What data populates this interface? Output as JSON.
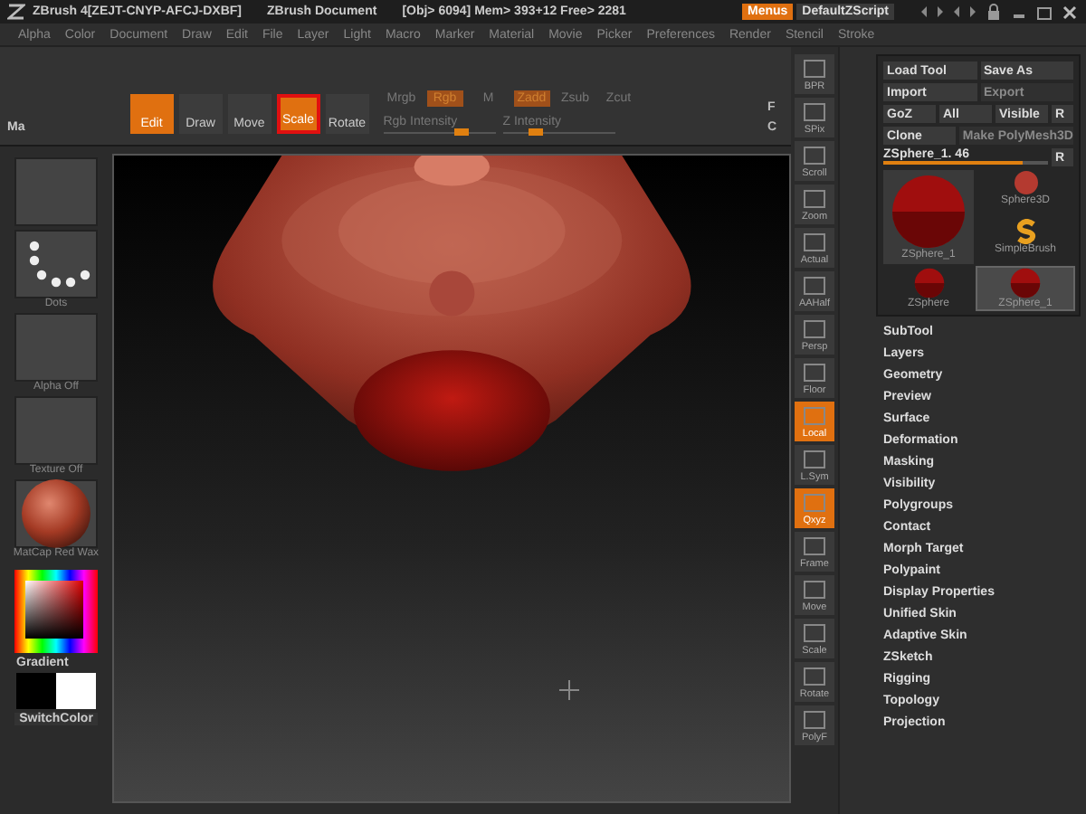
{
  "title_bar": {
    "app": "ZBrush 4[ZEJT-CNYP-AFCJ-DXBF]",
    "document": "ZBrush Document",
    "stats": "[Obj> 6094] Mem> 393+12 Free> 2281",
    "menus_button": "Menus",
    "script": "DefaultZScript"
  },
  "menu_bar": [
    "Alpha",
    "Color",
    "Document",
    "Draw",
    "Edit",
    "File",
    "Layer",
    "Light",
    "Macro",
    "Marker",
    "Material",
    "Movie",
    "Picker",
    "Preferences",
    "Render",
    "Stencil",
    "Stroke"
  ],
  "shelf": {
    "left_label": "Ma",
    "tools": [
      {
        "label": "Edit",
        "on": true,
        "highlighted": false
      },
      {
        "label": "Draw",
        "on": false,
        "highlighted": false
      },
      {
        "label": "Move",
        "on": false,
        "highlighted": false
      },
      {
        "label": "Scale",
        "on": true,
        "highlighted": true
      },
      {
        "label": "Rotate",
        "on": false,
        "highlighted": false
      }
    ],
    "channels": [
      {
        "label": "Mrgb",
        "on": false
      },
      {
        "label": "Rgb",
        "on": true
      },
      {
        "label": "M",
        "on": false
      }
    ],
    "z_modes": [
      {
        "label": "Zadd",
        "on": true
      },
      {
        "label": "Zsub",
        "on": false
      },
      {
        "label": "Zcut",
        "on": false
      }
    ],
    "sliders": [
      {
        "label": "Rgb Intensity",
        "level": 0.7
      },
      {
        "label": "Z Intensity",
        "level": 0.3
      }
    ],
    "edge_letters": [
      "F",
      "C"
    ]
  },
  "left_tray": {
    "thumbs": [
      {
        "kind": "blank"
      },
      {
        "kind": "dots",
        "label": "Dots"
      },
      {
        "kind": "blank",
        "label": "Alpha Off"
      },
      {
        "kind": "blank",
        "label": "Texture Off"
      },
      {
        "kind": "sphere",
        "label": "MatCap Red Wax"
      }
    ],
    "gradient_label": "Gradient",
    "switch_label": "SwitchColor"
  },
  "right_shelf": [
    {
      "label": "BPR",
      "on": false
    },
    {
      "label": "SPix",
      "on": false
    },
    {
      "label": "Scroll",
      "on": false
    },
    {
      "label": "Zoom",
      "on": false
    },
    {
      "label": "Actual",
      "on": false
    },
    {
      "label": "AAHalf",
      "on": false
    },
    {
      "label": "Persp",
      "on": false
    },
    {
      "label": "Floor",
      "on": false
    },
    {
      "label": "Local",
      "on": true
    },
    {
      "label": "L.Sym",
      "on": false
    },
    {
      "label": "Qxyz",
      "on": true
    },
    {
      "label": "Frame",
      "on": false
    },
    {
      "label": "Move",
      "on": false
    },
    {
      "label": "Scale",
      "on": false
    },
    {
      "label": "Rotate",
      "on": false
    },
    {
      "label": "PolyF",
      "on": false
    }
  ],
  "tool_panel": {
    "button_rows": [
      [
        {
          "label": "Load Tool",
          "disabled": false
        },
        {
          "label": "Save As",
          "disabled": false
        }
      ],
      [
        {
          "label": "Import",
          "disabled": false
        },
        {
          "label": "Export",
          "disabled": true
        }
      ],
      [
        {
          "label": "GoZ",
          "disabled": false
        },
        {
          "label": "All",
          "disabled": false
        },
        {
          "label": "Visible",
          "disabled": false
        },
        {
          "label": "R",
          "disabled": false
        }
      ],
      [
        {
          "label": "Clone",
          "disabled": false
        },
        {
          "label": "Make PolyMesh3D",
          "disabled": true
        }
      ]
    ],
    "slider": {
      "label": "ZSphere_1. 46",
      "level": 0.85,
      "button": "R"
    },
    "tools": [
      {
        "label": "ZSphere_1",
        "kind": "zsphere",
        "selected": false
      },
      {
        "label": "ZSphere",
        "kind": "zsphere",
        "selected": false
      },
      {
        "label": "Sphere3D",
        "kind": "sphere",
        "selected": false
      },
      {
        "label": "SimpleBrush",
        "kind": "brush",
        "selected": false
      },
      {
        "label": "ZSphere_1",
        "kind": "zsphere",
        "selected": true
      }
    ],
    "subpalettes": [
      "SubTool",
      "Layers",
      "Geometry",
      "Preview",
      "Surface",
      "Deformation",
      "Masking",
      "Visibility",
      "Polygroups",
      "Contact",
      "Morph Target",
      "Polypaint",
      "Display Properties",
      "Unified Skin",
      "Adaptive Skin",
      "ZSketch",
      "Rigging",
      "Topology",
      "Projection"
    ]
  }
}
